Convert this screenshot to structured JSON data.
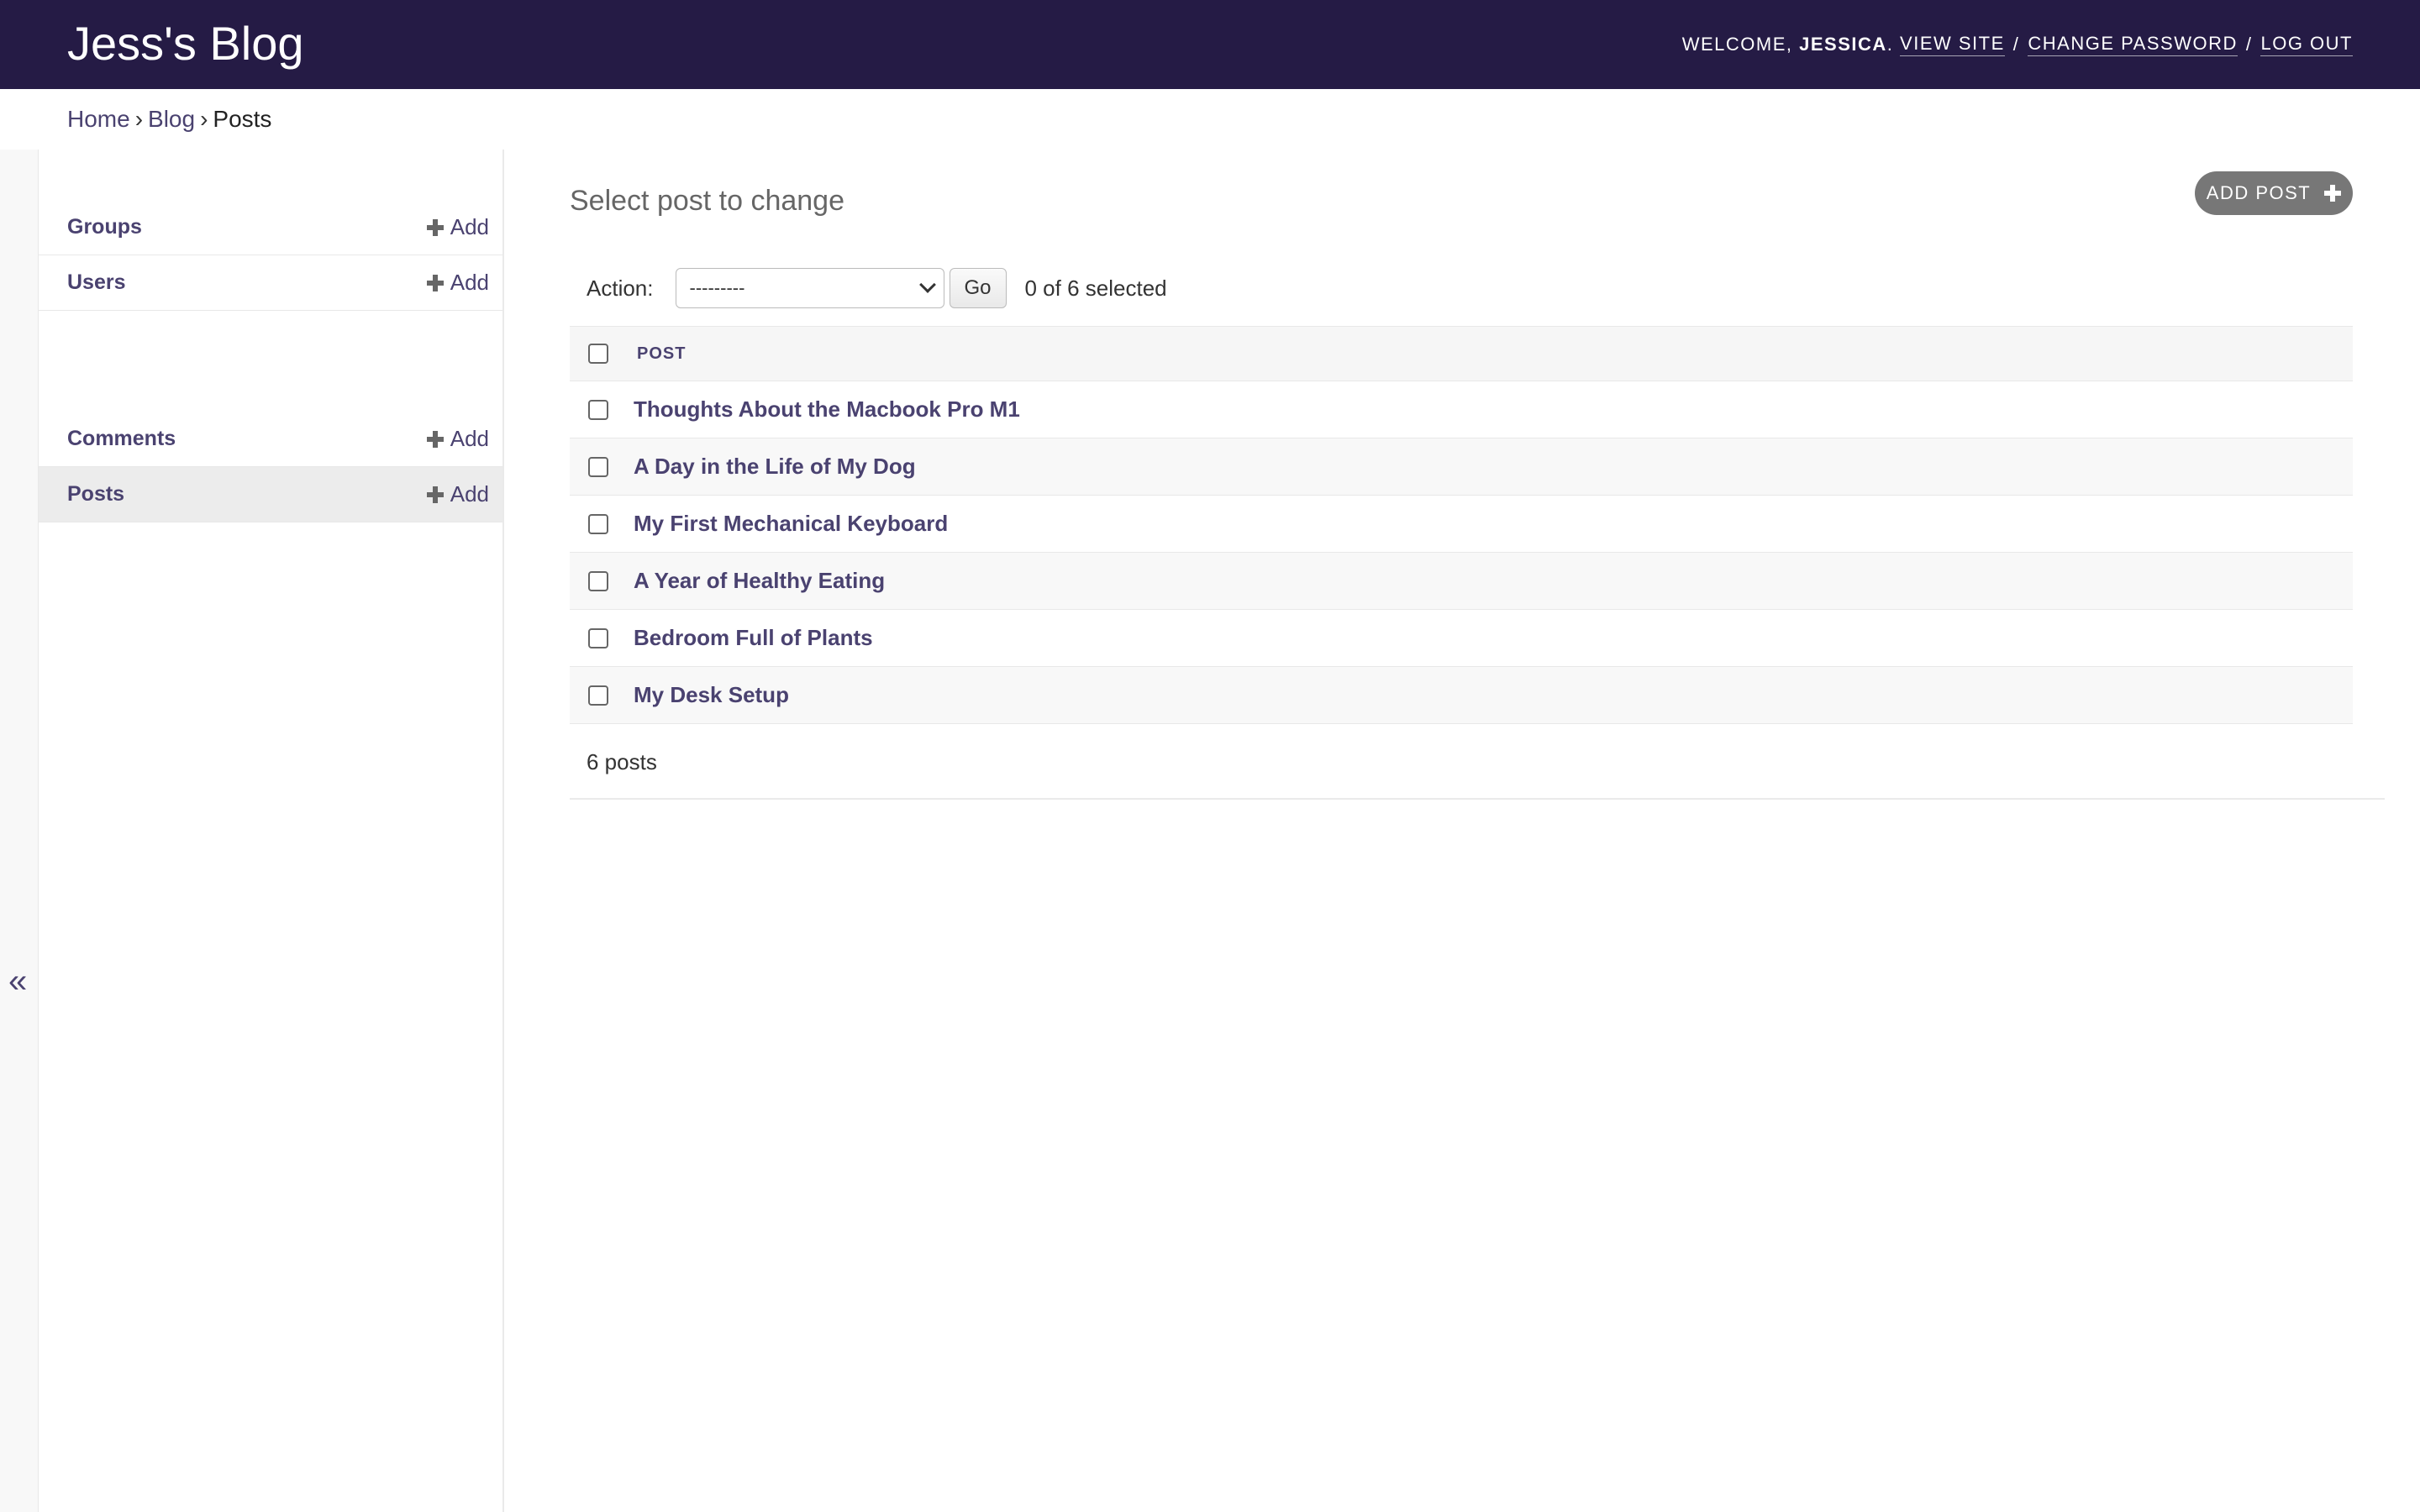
{
  "header": {
    "site_name": "Jess's Blog",
    "welcome_prefix": "WELCOME,",
    "username": "JESSICA",
    "view_site": "VIEW SITE",
    "change_password": "CHANGE PASSWORD",
    "log_out": "LOG OUT",
    "separator": "/"
  },
  "breadcrumbs": {
    "home": "Home",
    "app": "Blog",
    "current": "Posts",
    "separator": "›"
  },
  "sidebar": {
    "toggle_icon": "«",
    "auth_models": [
      {
        "label": "Groups",
        "add": "Add"
      },
      {
        "label": "Users",
        "add": "Add"
      }
    ],
    "blog_models": [
      {
        "label": "Comments",
        "add": "Add"
      },
      {
        "label": "Posts",
        "add": "Add",
        "active": true
      }
    ]
  },
  "content": {
    "title": "Select post to change",
    "add_button": "ADD POST",
    "action_label": "Action:",
    "action_select_value": "---------",
    "go_button": "Go",
    "selected_count": "0 of 6 selected",
    "column_header": "POST",
    "posts": [
      "Thoughts About the Macbook Pro M1",
      "A Day in the Life of My Dog",
      "My First Mechanical Keyboard",
      "A Year of Healthy Eating",
      "Bedroom Full of Plants",
      "My Desk Setup"
    ],
    "paginator": "6 posts"
  },
  "colors": {
    "header_bg": "#251b45",
    "link": "#4a4270",
    "active_row": "#ececec",
    "add_button_bg": "#777777"
  }
}
